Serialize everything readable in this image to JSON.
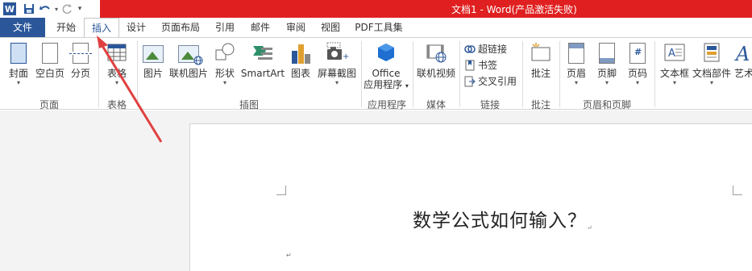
{
  "window": {
    "title": "文档1 - Word(产品激活失败)"
  },
  "qat": {
    "app_icon": "word-logo-icon",
    "items": [
      "save-icon",
      "undo-icon",
      "redo-icon",
      "customize-icon"
    ]
  },
  "tabs": {
    "file": "文件",
    "items": [
      "开始",
      "插入",
      "设计",
      "页面布局",
      "引用",
      "邮件",
      "审阅",
      "视图",
      "PDF工具集"
    ],
    "active": "插入"
  },
  "ribbon": {
    "groups": {
      "pages": {
        "label": "页面",
        "cover": "封面",
        "blank": "空白页",
        "break": "分页"
      },
      "table": {
        "label": "表格",
        "table": "表格"
      },
      "illustrations": {
        "label": "插图",
        "picture": "图片",
        "online_picture": "联机图片",
        "shapes": "形状",
        "smartart": "SmartArt",
        "chart": "图表",
        "screenshot": "屏幕截图"
      },
      "apps": {
        "label": "应用程序",
        "office_line1": "Office",
        "office_line2": "应用程序"
      },
      "media": {
        "label": "媒体",
        "online_video": "联机视频"
      },
      "links": {
        "label": "链接",
        "hyperlink": "超链接",
        "bookmark": "书签",
        "cross_ref": "交叉引用"
      },
      "comments": {
        "label": "批注",
        "comment": "批注"
      },
      "header_footer": {
        "label": "页眉和页脚",
        "header": "页眉",
        "footer": "页脚",
        "page_number": "页码"
      },
      "text": {
        "textbox": "文本框",
        "quick_parts": "文档部件",
        "wordart": "艺术"
      }
    }
  },
  "document": {
    "heading": "数学公式如何输入？",
    "para_mark": "↵"
  },
  "colors": {
    "word_blue": "#2b579a",
    "title_red": "#e02020",
    "arrow_red": "#e04040"
  }
}
